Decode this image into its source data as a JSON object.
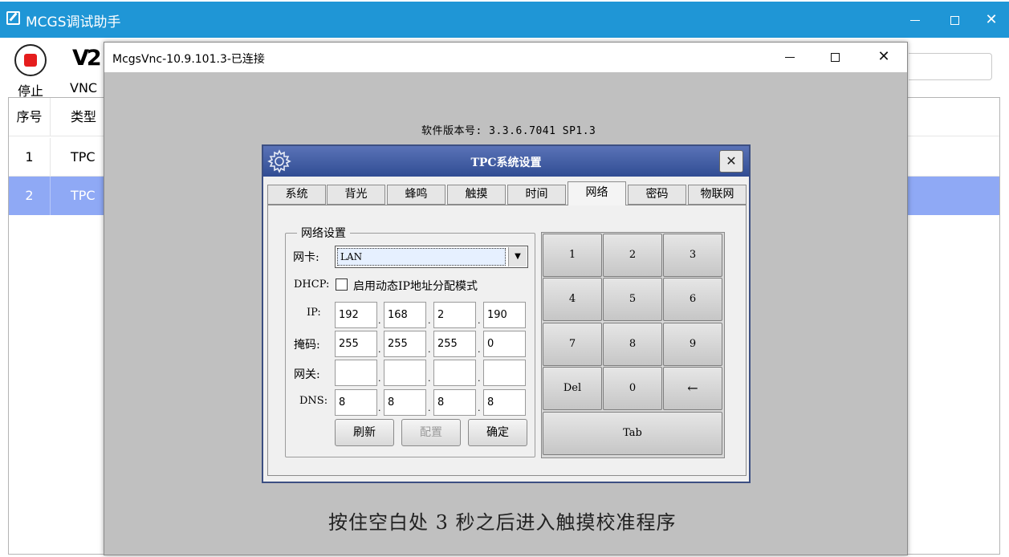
{
  "app": {
    "title": "MCGS调试助手",
    "window_controls": {
      "minimize": "—",
      "close": "✕"
    }
  },
  "toolbar": {
    "stop_label": "停止",
    "vnc_logo": "V2",
    "vnc_label": "VNC"
  },
  "table": {
    "headers": [
      "序号",
      "类型"
    ],
    "rows": [
      {
        "index": "1",
        "type": "TPC"
      },
      {
        "index": "2",
        "type": "TPC",
        "selected": true
      }
    ]
  },
  "vnc": {
    "title": "McgsVnc-10.9.101.3-已连接",
    "controls": {
      "close": "✕"
    },
    "software_version": "软件版本号: 3.3.6.7041 SP1.3",
    "calibrate_hint": "按住空白处 3 秒之后进入触摸校准程序"
  },
  "tpc_dialog": {
    "title": "TPC系统设置",
    "close_label": "✕",
    "tabs": [
      "系统",
      "背光",
      "蜂鸣",
      "触摸",
      "时间",
      "网络",
      "密码",
      "物联网"
    ],
    "active_tab": "网络",
    "network": {
      "group_title": "网络设置",
      "nic_label": "网卡:",
      "nic_value": "LAN",
      "dhcp_label": "DHCP:",
      "dhcp_option": "启用动态IP地址分配模式",
      "dhcp_checked": false,
      "ip_label": "IP:",
      "ip": [
        "192",
        "168",
        "2",
        "190"
      ],
      "mask_label": "掩码:",
      "mask": [
        "255",
        "255",
        "255",
        "0"
      ],
      "gateway_label": "网关:",
      "gateway": [
        "",
        "",
        "",
        ""
      ],
      "dns_label": "DNS:",
      "dns": [
        "8",
        "8",
        "8",
        "8"
      ],
      "dot": ".",
      "refresh_label": "刷新",
      "config_label": "配置",
      "ok_label": "确定"
    },
    "keypad": {
      "keys": [
        "1",
        "2",
        "3",
        "4",
        "5",
        "6",
        "7",
        "8",
        "9",
        "Del",
        "0",
        "←"
      ],
      "tab_key": "Tab"
    }
  },
  "colors": {
    "app_titlebar": "#1f96d6",
    "selected_row": "#8fa9f5",
    "stop_red": "#e51d1d",
    "tpc_titlebar": "#3c57a0"
  }
}
